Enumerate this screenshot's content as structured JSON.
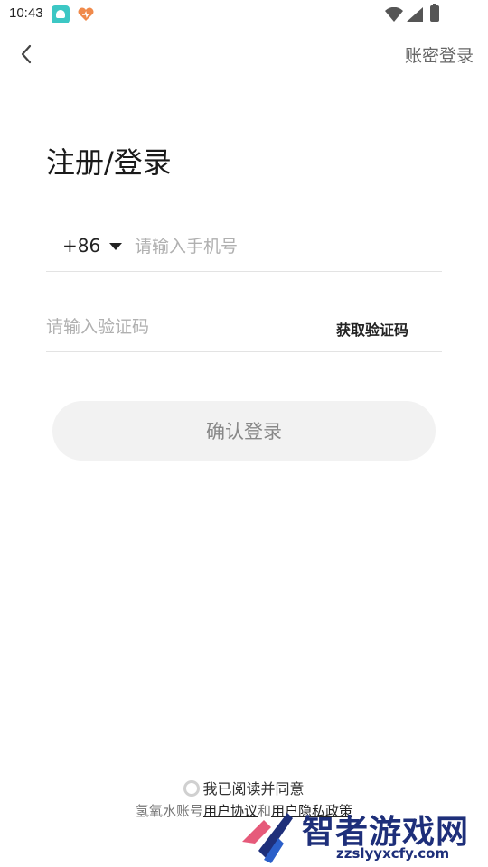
{
  "status_bar": {
    "time": "10:43"
  },
  "header": {
    "back_icon": "chevron-left-icon",
    "action_label": "账密登录"
  },
  "main": {
    "title": "注册/登录",
    "phone": {
      "country_code": "+86",
      "value": "",
      "placeholder": "请输入手机号"
    },
    "code": {
      "value": "",
      "placeholder": "请输入验证码",
      "get_code_label": "获取验证码"
    },
    "confirm_label": "确认登录"
  },
  "footer": {
    "agree_text": "我已阅读并同意",
    "brand_prefix": "氢氧水账号",
    "user_agreement": "用户协议",
    "and_text": "和",
    "privacy_policy": "用户隐私政策"
  },
  "watermark": {
    "text": "智者游戏网",
    "url": "zzslyyxcfy.com"
  },
  "colors": {
    "accent_teal": "#3cc7c4",
    "button_bg": "#f2f2f2",
    "placeholder": "#b0b0b0",
    "watermark_blue": "#1e2f7a"
  }
}
